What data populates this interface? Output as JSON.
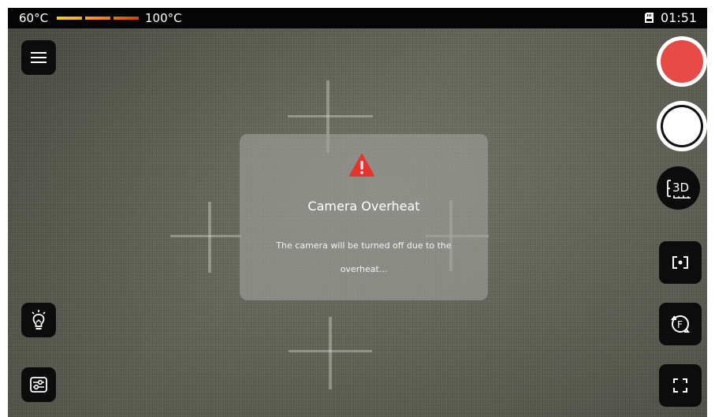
{
  "status_bar": {
    "temp_min": "60°C",
    "temp_max": "100°C",
    "time": "01:51",
    "sd_card_icon": "sd-card-icon"
  },
  "dialog": {
    "icon": "warning-icon",
    "title": "Camera Overheat",
    "message": "The camera will be turned off due to the overheat..."
  },
  "controls": {
    "left": [
      "menu-icon",
      "light-bulb-icon",
      "settings-sliders-icon"
    ],
    "right": [
      "record-button",
      "capture-button",
      "3d-measure-icon",
      "focus-frame-icon",
      "rotate-flip-icon",
      "fullscreen-icon"
    ]
  },
  "colors": {
    "record": "#e84a46",
    "capture": "#ffffff",
    "warning": "#e8322d",
    "button_bg": "#0c0c0c"
  }
}
